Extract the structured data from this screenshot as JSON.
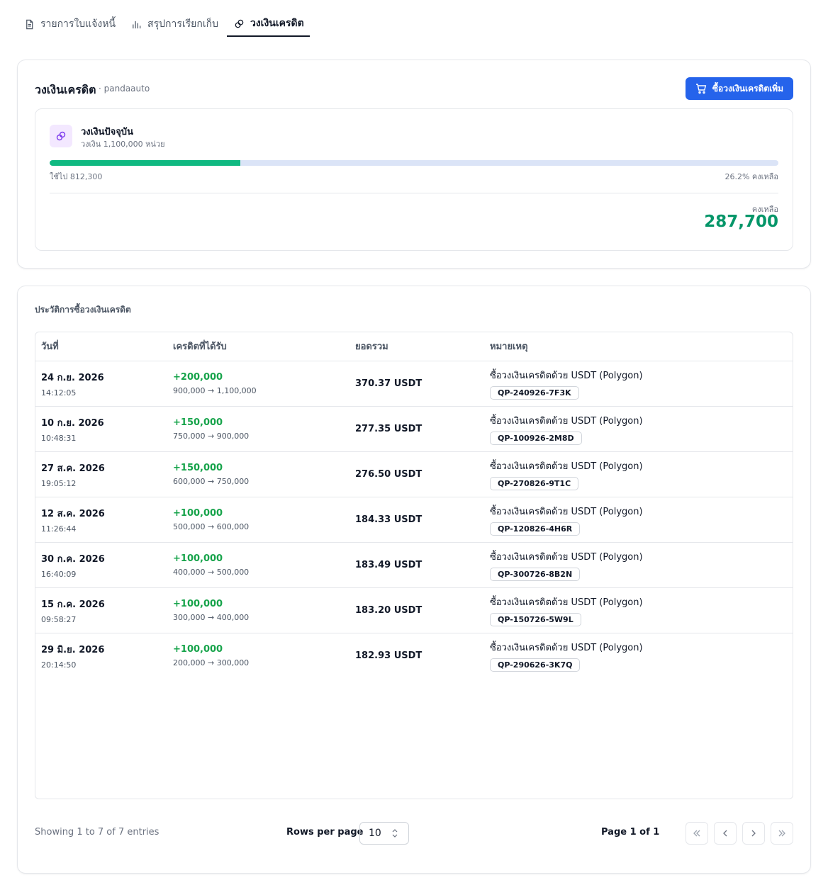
{
  "tabs": [
    {
      "label": "รายการใบแจ้งหนี้",
      "icon": "document-icon",
      "active": false
    },
    {
      "label": "สรุปการเรียกเก็บ",
      "icon": "bar-chart-icon",
      "active": false
    },
    {
      "label": "วงเงินเครดิต",
      "icon": "link-icon",
      "active": true
    }
  ],
  "credit": {
    "title": "วงเงินเครดิต",
    "account": "· pandaauto",
    "buy_label": "ซื้อวงเงินเครดิตเพิ่ม",
    "current_title": "วงเงินปัจจุบัน",
    "limit_text": "วงเงิน 1,100,000 หน่วย",
    "used_fraction": 0.262,
    "used_text": "ใช้ไป 812,300",
    "remaining_pct_text": "26.2% คงเหลือ",
    "remaining_label": "คงเหลือ",
    "remaining_value": "287,700",
    "accent_color": "#10b981",
    "brand_color": "#2563eb"
  },
  "history": {
    "title": "ประวัติการซื้อวงเงินเครดิต",
    "columns": [
      "วันที่",
      "เครดิตที่ได้รับ",
      "ยอดรวม",
      "หมายเหตุ"
    ],
    "rows": [
      {
        "date": "24 ก.ย. 2026",
        "time": "14:12:05",
        "credit": "+200,000",
        "range": "900,000 → 1,100,000",
        "total": "370.37 USDT",
        "note": "ซื้อวงเงินเครดิตด้วย USDT (Polygon)",
        "ref": "QP-240926-7F3K"
      },
      {
        "date": "10 ก.ย. 2026",
        "time": "10:48:31",
        "credit": "+150,000",
        "range": "750,000 → 900,000",
        "total": "277.35 USDT",
        "note": "ซื้อวงเงินเครดิตด้วย USDT (Polygon)",
        "ref": "QP-100926-2M8D"
      },
      {
        "date": "27 ส.ค. 2026",
        "time": "19:05:12",
        "credit": "+150,000",
        "range": "600,000 → 750,000",
        "total": "276.50 USDT",
        "note": "ซื้อวงเงินเครดิตด้วย USDT (Polygon)",
        "ref": "QP-270826-9T1C"
      },
      {
        "date": "12 ส.ค. 2026",
        "time": "11:26:44",
        "credit": "+100,000",
        "range": "500,000 → 600,000",
        "total": "184.33 USDT",
        "note": "ซื้อวงเงินเครดิตด้วย USDT (Polygon)",
        "ref": "QP-120826-4H6R"
      },
      {
        "date": "30 ก.ค. 2026",
        "time": "16:40:09",
        "credit": "+100,000",
        "range": "400,000 → 500,000",
        "total": "183.49 USDT",
        "note": "ซื้อวงเงินเครดิตด้วย USDT (Polygon)",
        "ref": "QP-300726-8B2N"
      },
      {
        "date": "15 ก.ค. 2026",
        "time": "09:58:27",
        "credit": "+100,000",
        "range": "300,000 → 400,000",
        "total": "183.20 USDT",
        "note": "ซื้อวงเงินเครดิตด้วย USDT (Polygon)",
        "ref": "QP-150726-5W9L"
      },
      {
        "date": "29 มิ.ย. 2026",
        "time": "20:14:50",
        "credit": "+100,000",
        "range": "200,000 → 300,000",
        "total": "182.93 USDT",
        "note": "ซื้อวงเงินเครดิตด้วย USDT (Polygon)",
        "ref": "QP-290626-3K7Q"
      }
    ]
  },
  "pagination": {
    "showing": "Showing 1 to 7 of 7 entries",
    "rows_per_page_label": "Rows per page",
    "rows_per_page_value": "10",
    "page_label": "Page 1 of 1"
  }
}
